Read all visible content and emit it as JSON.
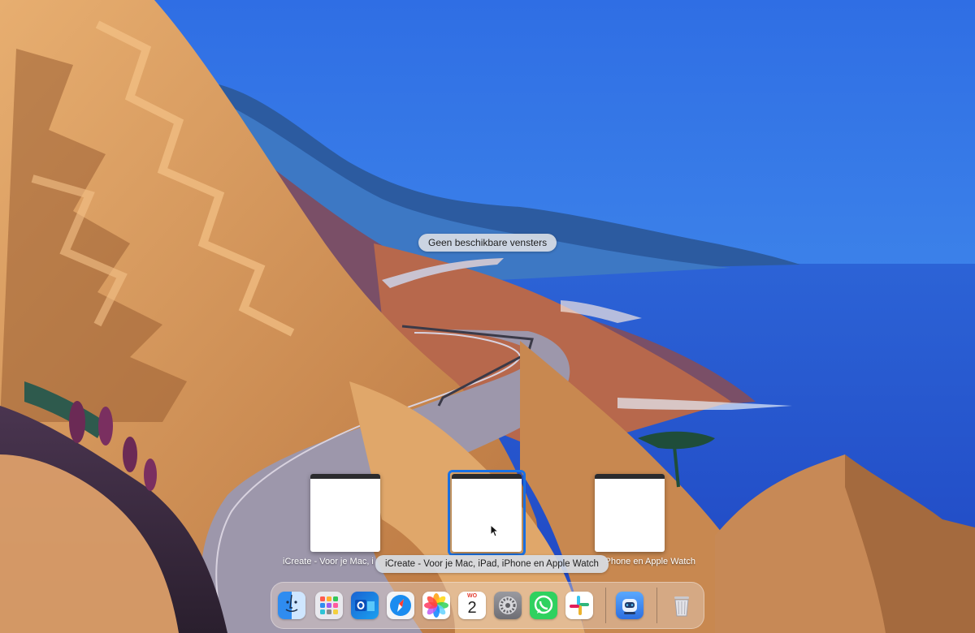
{
  "desktop": {
    "no_windows_label": "Geen beschikbare vensters"
  },
  "app_expose": {
    "windows": [
      {
        "caption": "iCreate - Voor je Mac, iPad, iPhone en Apple Watch",
        "selected": false
      },
      {
        "caption": "iCreate - Voor je Mac, iPad, iPhone en Apple Watch",
        "selected": true
      },
      {
        "caption": "iCreate - Voor je Mac, iPad, iPhone en Apple Watch",
        "selected": false
      }
    ]
  },
  "dock": {
    "apps": [
      {
        "name": "Finder",
        "icon": "finder-icon"
      },
      {
        "name": "Launchpad",
        "icon": "launchpad-icon"
      },
      {
        "name": "Outlook",
        "icon": "outlook-icon"
      },
      {
        "name": "Safari",
        "icon": "safari-icon"
      },
      {
        "name": "Foto's",
        "icon": "photos-icon"
      },
      {
        "name": "Agenda",
        "icon": "calendar-icon"
      },
      {
        "name": "Systeeminstellingen",
        "icon": "settings-icon"
      },
      {
        "name": "WhatsApp",
        "icon": "whatsapp-icon"
      },
      {
        "name": "Slack",
        "icon": "slack-icon"
      },
      {
        "name": "Proxyman",
        "icon": "app-icon"
      },
      {
        "name": "Prullenmand",
        "icon": "trash-icon"
      }
    ],
    "calendar": {
      "month": "WO",
      "day": "2"
    }
  },
  "colors": {
    "sky": "#3f7fe6",
    "sea": "#2a5fd8",
    "selection": "#1a73e8"
  }
}
